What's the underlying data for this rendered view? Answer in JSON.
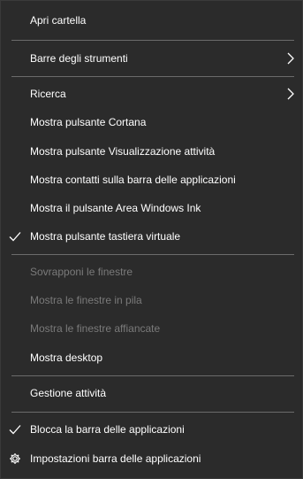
{
  "menu": {
    "apri_cartella": "Apri cartella",
    "barre_strumenti": "Barre degli strumenti",
    "ricerca": "Ricerca",
    "mostra_cortana": "Mostra pulsante Cortana",
    "mostra_visualizzazione_attivita": "Mostra pulsante Visualizzazione attività",
    "mostra_contatti": "Mostra contatti sulla barra delle applicazioni",
    "mostra_windows_ink": "Mostra il pulsante Area Windows Ink",
    "mostra_tastiera_virtuale": "Mostra pulsante tastiera virtuale",
    "sovrapponi_finestre": "Sovrapponi le finestre",
    "finestre_in_pila": "Mostra le finestre in pila",
    "finestre_affiancate": "Mostra le finestre affiancate",
    "mostra_desktop": "Mostra desktop",
    "gestione_attivita": "Gestione attività",
    "blocca_barra": "Blocca la barra delle applicazioni",
    "impostazioni_barra": "Impostazioni barra delle applicazioni"
  },
  "state": {
    "tastiera_virtuale_checked": true,
    "blocca_barra_checked": true
  },
  "icons": {
    "check": "check-icon",
    "submenu": "chevron-right-icon",
    "settings": "gear-icon"
  },
  "colors": {
    "background": "#2b2b2b",
    "text": "#ffffff",
    "disabled_text": "#7a7a7a",
    "separator": "#6b6b6b"
  }
}
